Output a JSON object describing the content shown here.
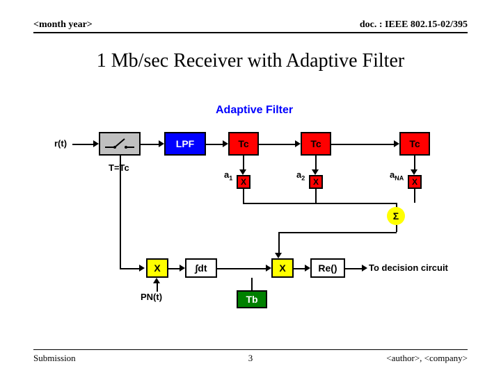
{
  "header": {
    "left": "<month year>",
    "right": "doc. : IEEE 802.15-02/395"
  },
  "title": "1 Mb/sec Receiver with Adaptive Filter",
  "filter_label": "Adaptive Filter",
  "input_label": "r(t)",
  "period_label": "T=Tc",
  "lpf_label": "LPF",
  "delay_label": "Tc",
  "tap_labels": {
    "a1_pre": "a",
    "a1_sub": "1",
    "a2_pre": "a",
    "a2_sub": "2",
    "aN_pre": "a",
    "aN_sub": "NA"
  },
  "multiplier_label": "X",
  "sum_label": "Σ",
  "integrator_label": "∫dt",
  "reblock_label": "Re()",
  "pn_label": "PN(t)",
  "tb_label": "Tb",
  "output_label": "To decision circuit",
  "footer": {
    "left": "Submission",
    "center": "3",
    "right": "<author>, <company>"
  }
}
